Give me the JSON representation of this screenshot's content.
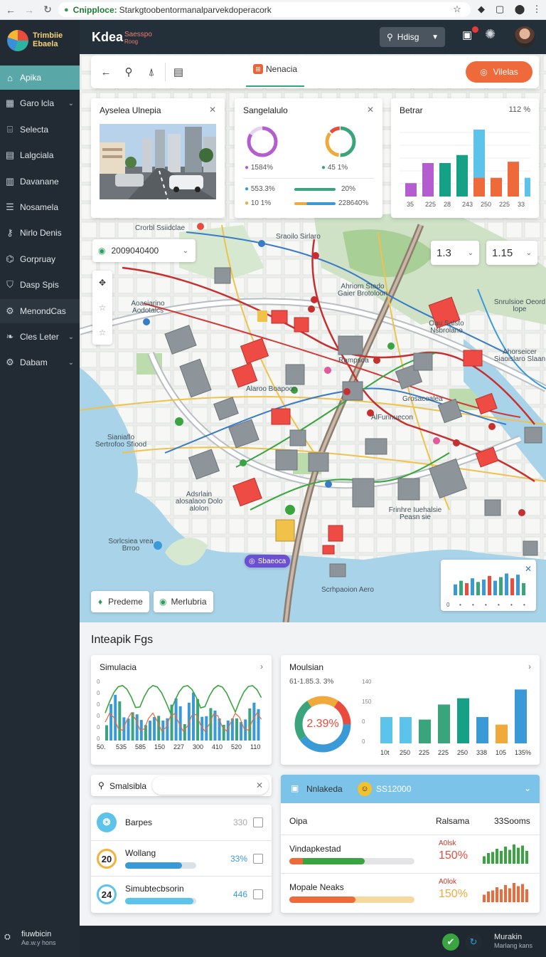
{
  "browser": {
    "url_host": "Cnipploce:",
    "url_path": "Starkgtoobentormanalparvekdoperacork",
    "icons": [
      "back-icon",
      "forward-icon",
      "reload-icon",
      "bookmark-star-icon",
      "extension-icon",
      "profile-icon",
      "menu-icon"
    ]
  },
  "sidebar": {
    "logo_line1": "Trimbiie",
    "logo_line2": "Ebaela",
    "items": [
      {
        "label": "Apika",
        "icon": "home-icon",
        "active": true,
        "chevron": false
      },
      {
        "label": "Garo lcla",
        "icon": "grid-icon",
        "active": false,
        "chevron": true
      },
      {
        "label": "Selecta",
        "icon": "building-icon",
        "active": false,
        "chevron": false
      },
      {
        "label": "Lalgciala",
        "icon": "document-icon",
        "active": false,
        "chevron": false
      },
      {
        "label": "Davanane",
        "icon": "layout-icon",
        "active": false,
        "chevron": false
      },
      {
        "label": "Nosamela",
        "icon": "list-icon",
        "active": false,
        "chevron": false
      },
      {
        "label": "Nirlo Denis",
        "icon": "key-icon",
        "active": false,
        "chevron": false
      },
      {
        "label": "Gorpruay",
        "icon": "tag-icon",
        "active": false,
        "chevron": false
      },
      {
        "label": "Dasp Spis",
        "icon": "shield-icon",
        "active": false,
        "chevron": false
      },
      {
        "label": "MenondCas",
        "icon": "gear-icon",
        "active": false,
        "chevron": false,
        "dark": true
      },
      {
        "label": "Cles Leter",
        "icon": "leaf-icon",
        "active": false,
        "chevron": true
      },
      {
        "label": "Dabam",
        "icon": "settings-icon",
        "active": false,
        "chevron": true
      }
    ],
    "footer_line1": "fiuwbicin",
    "footer_line2": "Ae.w.y hons"
  },
  "topbar": {
    "title": "Kdea",
    "subtitle_line1": "Saesspo",
    "subtitle_line2": "Roog",
    "search_label": "Hdisg"
  },
  "toolbar": {
    "tab_label": "Nenacia",
    "button_label": "Vilelas"
  },
  "cards": {
    "photo": {
      "title": "Ayselea Ulnepia"
    },
    "stats": {
      "title": "Sangelalulo",
      "ring1_label": "1584%",
      "ring2_label": "45 1%",
      "bar1_label": "553.3%",
      "bar1_value": "20%",
      "bar2_label": "10 1%",
      "bar2_value": "228640%"
    },
    "bars": {
      "title": "Betrar",
      "value": "112 %",
      "ticks": [
        "35",
        "225",
        "28",
        "243",
        "250",
        "225",
        "33"
      ]
    }
  },
  "map": {
    "search_value": "2009040400",
    "zoom1": "1.3",
    "zoom2": "1.15",
    "labels": [
      {
        "text": "Crorbl Ssiidclae",
        "name": "map-label-top"
      },
      {
        "text": "Sraoilo Sirlaro",
        "name": "map-label-sirlaro"
      },
      {
        "text": "Ahriorn Stado Gaier Brotoloon",
        "name": "map-label-stadium"
      },
      {
        "text": "Snrulsioe Oeord lope",
        "name": "map-label-east"
      },
      {
        "text": "Aoasiarino Aodotalcs",
        "name": "map-label-west"
      },
      {
        "text": "Oau Salsto Nsbrolano",
        "name": "map-label-center-east"
      },
      {
        "text": "Rampsoa",
        "name": "map-label-rampsoa"
      },
      {
        "text": "Alaroo Boapoon",
        "name": "map-label-boapoon"
      },
      {
        "text": "Ahorseicer Siaoislaro Slaan",
        "name": "map-label-far-east"
      },
      {
        "text": "Grosacoalea",
        "name": "map-label-grosacoalea"
      },
      {
        "text": "AlFunnuecon",
        "name": "map-label-funnuecon"
      },
      {
        "text": "Sianiaflo Sertrofoo Sfiood",
        "name": "map-label-river-west"
      },
      {
        "text": "Adsrlain alosalaoo Dolo alolon",
        "name": "map-label-south-west"
      },
      {
        "text": "Frinhre Iuehalsie Peasn sie",
        "name": "map-label-south-east"
      },
      {
        "text": "Sorlcsiea vrea Brroo",
        "name": "map-label-water"
      },
      {
        "text": "Scrhpaoion Aero",
        "name": "map-label-water-south"
      }
    ],
    "badge_label": "Sbaeoca",
    "btn_left": "Predeme",
    "btn_right": "Merlubria"
  },
  "analytics": {
    "section_title": "Inteapik Fgs",
    "sim": {
      "title": "Simulacia",
      "x_ticks": [
        "50.",
        "535",
        "585",
        "150",
        "227",
        "300",
        "410",
        "520",
        "110"
      ],
      "y_ticks": [
        "0",
        "0",
        "0",
        "0",
        "0",
        "0"
      ]
    },
    "moul": {
      "title": "Moulsian",
      "subtitle": "61-1.85.3. 3%",
      "donut_label": "2.39%",
      "y_ticks": [
        "140",
        "150",
        "0",
        "0"
      ],
      "x_ticks": [
        "10t",
        "250",
        "225",
        "225",
        "250",
        "338",
        "105",
        "135%"
      ]
    }
  },
  "list_panel": {
    "search_label": "Smalsibla",
    "rows": [
      {
        "badge": "",
        "label": "Barpes",
        "value": "330",
        "icon": "water-drop-icon",
        "bar": 0
      },
      {
        "badge": "20",
        "label": "Wollang",
        "value": "33%",
        "bar": 0.33
      },
      {
        "badge": "24",
        "label": "Simubtecbsorin",
        "value": "446",
        "bar": 0.46
      }
    ]
  },
  "right_panel": {
    "header_label": "Nnlakeda",
    "header_value": "SS12000",
    "col1": "Oipa",
    "col2": "Ralsama",
    "col3": "33Sooms",
    "rows": [
      {
        "label": "Vindapkestad",
        "stat_top": "A0lsk",
        "stat_value": "150%",
        "bar": 0.6
      },
      {
        "label": "Mopale Neaks",
        "stat_top": "A0lok",
        "stat_value": "150%",
        "bar": 0.53
      }
    ]
  },
  "footer": {
    "right_line1": "Murakin",
    "right_line2": "Marlang kans"
  },
  "colors": {
    "accent": "#5aa7a8",
    "orange": "#ee6a3a",
    "green": "#3aa57c",
    "blue": "#3a9ad8",
    "sidebar": "#222b34"
  }
}
